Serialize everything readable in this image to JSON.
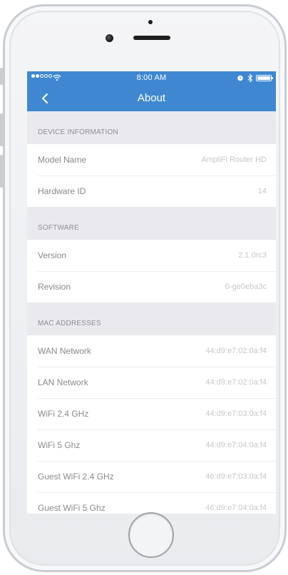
{
  "status_bar": {
    "time": "8:00 AM",
    "signal_dots": [
      true,
      true,
      false,
      false,
      false
    ]
  },
  "nav": {
    "title": "About",
    "back_icon": "chevron-left-icon"
  },
  "sections": [
    {
      "header": "DEVICE INFORMATION",
      "rows": [
        {
          "label": "Model Name",
          "value": "AmpliFi Router HD"
        },
        {
          "label": "Hardware ID",
          "value": "14"
        }
      ]
    },
    {
      "header": "SOFTWARE",
      "rows": [
        {
          "label": "Version",
          "value": "2.1.0rc3"
        },
        {
          "label": "Revision",
          "value": "0-ge0eba3c"
        }
      ]
    },
    {
      "header": "MAC ADDRESSES",
      "rows": [
        {
          "label": "WAN Network",
          "value": "44:d9:e7:02:0a:f4"
        },
        {
          "label": "LAN Network",
          "value": "44:d9:e7:02:0a:f4"
        },
        {
          "label": "WiFi 2.4 GHz",
          "value": "44:d9:e7:03:0a:f4"
        },
        {
          "label": "WiFi 5 Ghz",
          "value": "44:d9:e7:04:0a:f4"
        },
        {
          "label": "Guest WiFi 2.4 GHz",
          "value": "46:d9:e7:03:0a:f4"
        },
        {
          "label": "Guest WiFi 5 Ghz",
          "value": "46:d9:e7:04:0a:f4"
        }
      ]
    }
  ],
  "colors": {
    "accent": "#3f88d1",
    "background": "#efeff4",
    "label": "#8a8a8f",
    "value": "#c7c7cc"
  }
}
